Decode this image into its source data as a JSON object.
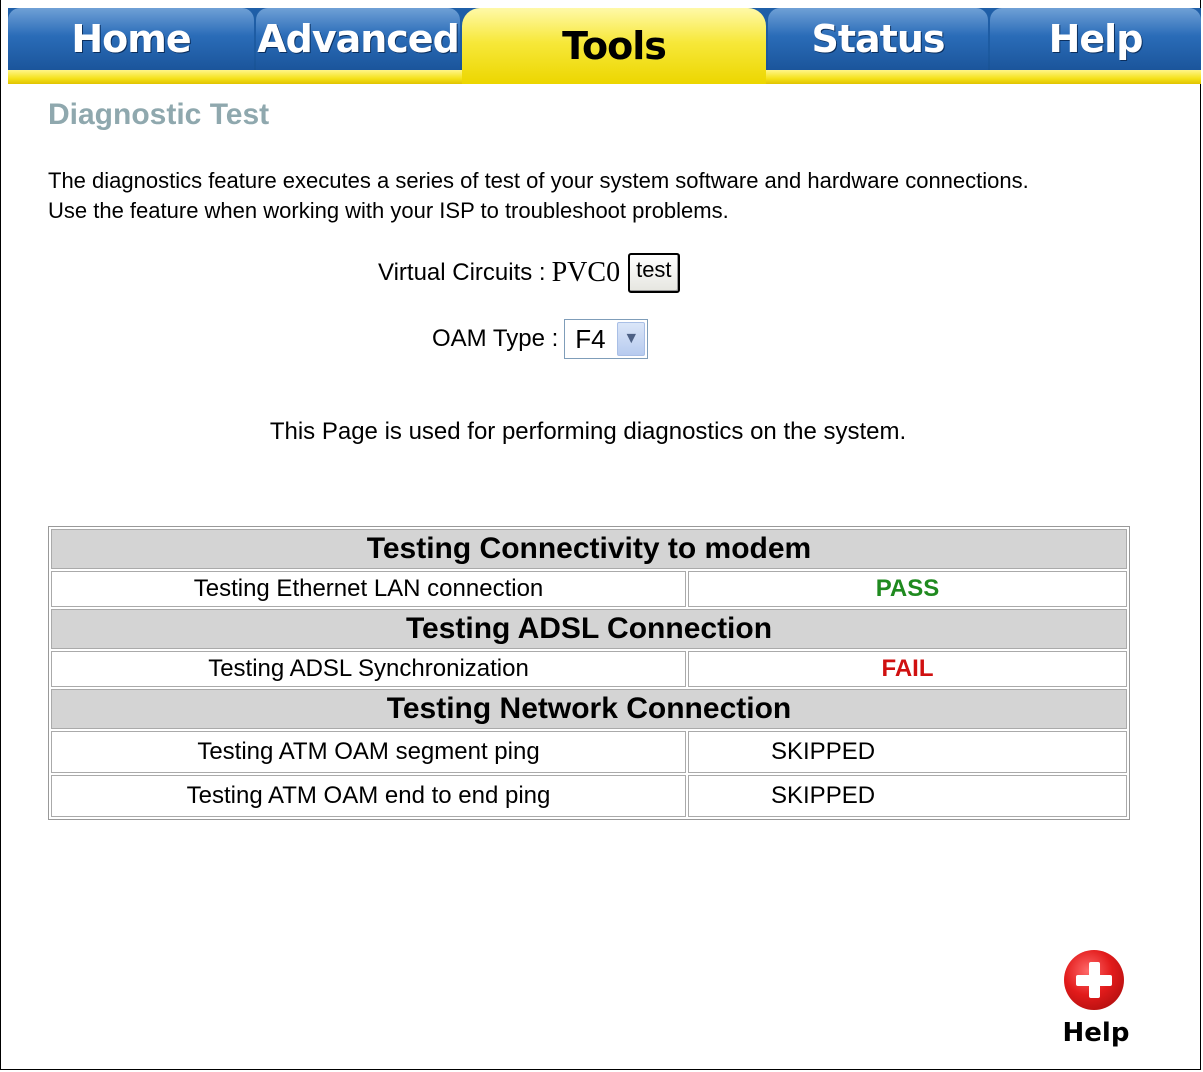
{
  "tabs": [
    {
      "label": "Home"
    },
    {
      "label": "Advanced"
    },
    {
      "label": "Tools"
    },
    {
      "label": "Status"
    },
    {
      "label": "Help"
    }
  ],
  "page": {
    "title": "Diagnostic Test",
    "intro": "The diagnostics feature executes a series of test of your system software and hardware connections. Use the feature when working with your ISP to troubleshoot problems.",
    "note": "This Page is used for performing diagnostics on the system."
  },
  "virtual_circuits": {
    "label": "Virtual Circuits :",
    "value": "PVC0",
    "button_label": "test"
  },
  "oam_type": {
    "label": "OAM Type :",
    "selected": "F4"
  },
  "results": {
    "sections": [
      {
        "title": "Testing Connectivity to modem",
        "rows": [
          {
            "test": "Testing Ethernet LAN connection",
            "result": "PASS"
          }
        ]
      },
      {
        "title": "Testing ADSL Connection",
        "rows": [
          {
            "test": "Testing ADSL Synchronization",
            "result": "FAIL"
          }
        ]
      },
      {
        "title": "Testing Network Connection",
        "rows": [
          {
            "test": "Testing ATM OAM segment ping",
            "result": "SKIPPED"
          },
          {
            "test": "Testing ATM OAM end to end ping",
            "result": "SKIPPED"
          }
        ]
      }
    ]
  },
  "help_button": {
    "label": "Help"
  },
  "colors": {
    "pass": "#1f8a1f",
    "fail": "#d01010",
    "title": "#8fa8ae",
    "tab_active": "#f7e83a",
    "tab_blue": "#1c5aa0"
  }
}
